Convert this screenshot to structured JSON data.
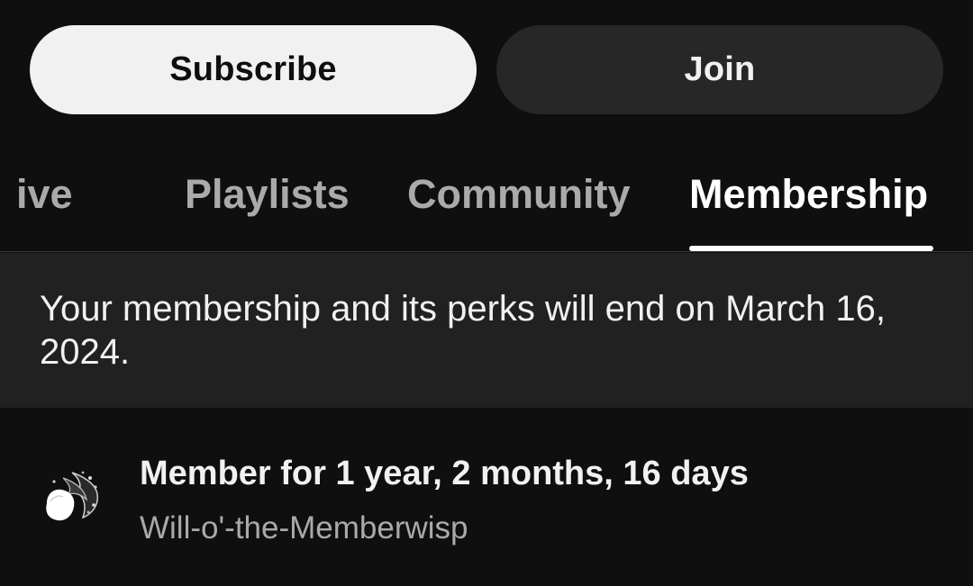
{
  "actions": {
    "subscribe_label": "Subscribe",
    "join_label": "Join"
  },
  "tabs": [
    {
      "label": "Live",
      "visible_text": "ive",
      "active": false
    },
    {
      "label": "Playlists",
      "active": false
    },
    {
      "label": "Community",
      "active": false
    },
    {
      "label": "Membership",
      "active": true
    }
  ],
  "notice": {
    "text": "Your membership and its perks will end on March 16, 2024."
  },
  "membership": {
    "duration": "Member for 1 year, 2 months, 16 days",
    "level": "Will-o'-the-Memberwisp",
    "badge_icon": "wisp-badge-icon"
  },
  "colors": {
    "background": "#0f0f0f",
    "subscribe_bg": "#f1f1f1",
    "join_bg": "#272727",
    "notice_bg": "#212121",
    "tab_inactive": "#aaaaaa",
    "tab_active": "#ffffff"
  }
}
